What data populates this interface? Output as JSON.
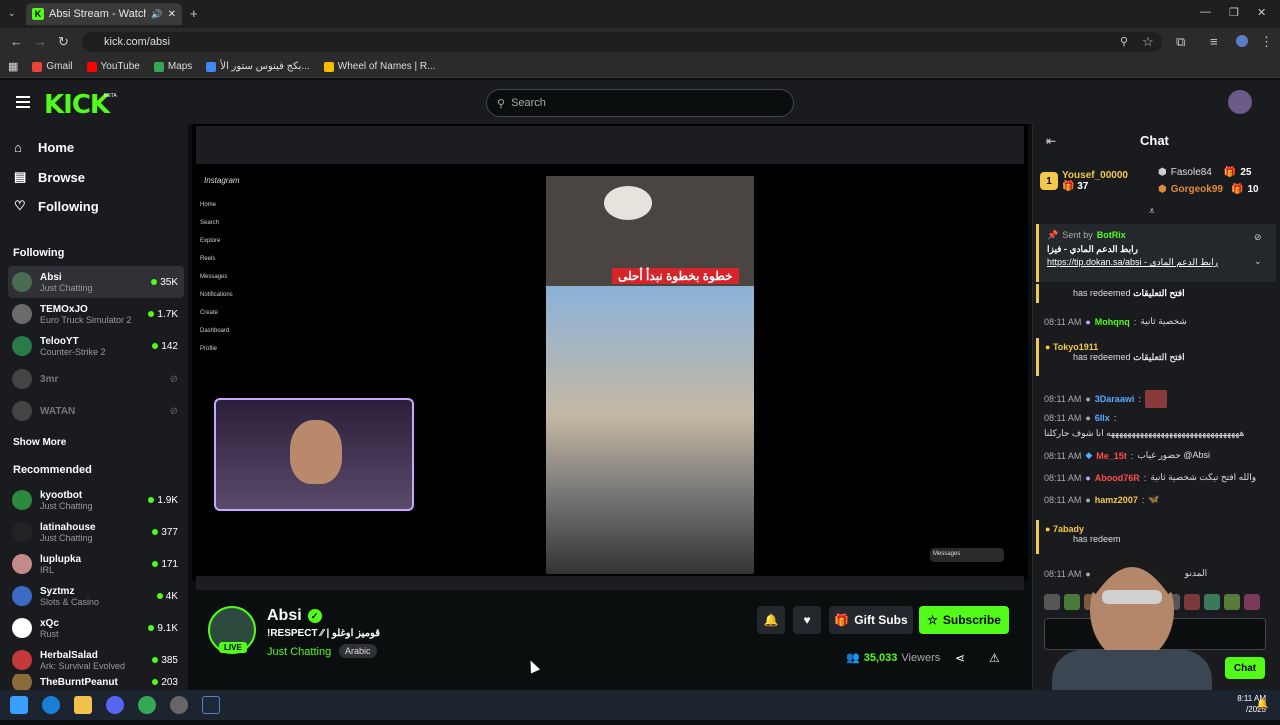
{
  "browser": {
    "tab_title": "Absi Stream - Watch Live o",
    "url": "kick.com/absi",
    "bookmarks": [
      "Gmail",
      "YouTube",
      "Maps",
      "بكج فينوس ستور الأ...",
      "Wheel of Names | R..."
    ]
  },
  "header": {
    "logo": "KICK",
    "beta": "BETA",
    "search_placeholder": "Search"
  },
  "sidebar": {
    "nav": [
      {
        "label": "Home",
        "icon": "home-icon"
      },
      {
        "label": "Browse",
        "icon": "browse-icon"
      },
      {
        "label": "Following",
        "icon": "heart-icon"
      }
    ],
    "following_title": "Following",
    "following": [
      {
        "name": "Absi",
        "category": "Just Chatting",
        "viewers": "35K",
        "live": true,
        "avatar_color": "#4a6b52"
      },
      {
        "name": "TEMOxJO",
        "category": "Euro Truck Simulator 2",
        "viewers": "1.7K",
        "live": true,
        "avatar_color": "#6b6b6b"
      },
      {
        "name": "TelooYT",
        "category": "Counter-Strike 2",
        "viewers": "142",
        "live": true,
        "avatar_color": "#2b7a4a"
      },
      {
        "name": "3mr",
        "category": "",
        "viewers": "",
        "live": false,
        "avatar_color": "#444444"
      },
      {
        "name": "WATAN",
        "category": "",
        "viewers": "",
        "live": false,
        "avatar_color": "#444444"
      }
    ],
    "show_more": "Show More",
    "recommended_title": "Recommended",
    "recommended": [
      {
        "name": "kyootbot",
        "category": "Just Chatting",
        "viewers": "1.9K",
        "avatar_color": "#2b8a3e"
      },
      {
        "name": "latinahouse",
        "category": "Just Chatting",
        "viewers": "377",
        "avatar_color": "#222222"
      },
      {
        "name": "luplupka",
        "category": "IRL",
        "viewers": "171",
        "avatar_color": "#c48a8a"
      },
      {
        "name": "Syztmz",
        "category": "Slots & Casino",
        "viewers": "4K",
        "avatar_color": "#3a6bc4"
      },
      {
        "name": "xQc",
        "category": "Rust",
        "viewers": "9.1K",
        "avatar_color": "#ffffff"
      },
      {
        "name": "HerbalSalad",
        "category": "Ark: Survival Evolved",
        "viewers": "385",
        "avatar_color": "#c43a3a"
      },
      {
        "name": "TheBurntPeanut",
        "category": "",
        "viewers": "203",
        "avatar_color": "#8a6b3a"
      }
    ]
  },
  "stream": {
    "channel": "Absi",
    "title": "!RESPECT ⁄⁄ | قوميز اوغلو",
    "category": "Just Chatting",
    "language": "Arabic",
    "live_label": "LIVE",
    "gift_label": "Gift Subs",
    "subscribe_label": "Subscribe",
    "viewers": "35,033",
    "viewers_label": "Viewers",
    "video_caption": "خطوة بخطوة نبدأ أحلى",
    "ig_nav": [
      "Home",
      "Search",
      "Explore",
      "Reels",
      "Messages",
      "Notifications",
      "Create",
      "Dashboard",
      "Profile"
    ],
    "ig_brand": "Instagram",
    "ig_messages": "Messages"
  },
  "chat": {
    "title": "Chat",
    "leaderboard": [
      {
        "rank": "1",
        "name": "Yousef_00000",
        "score": "37"
      },
      {
        "name": "Fasole84",
        "score": "25"
      },
      {
        "name": "Gorgeok99",
        "score": "10"
      }
    ],
    "pinned": {
      "sent_by": "Sent by",
      "bot": "BotRix",
      "message": "رابط الدعم المادي - فيزا",
      "link": "https://tip.dokan.sa/absi - رابط الدعم المادي"
    },
    "messages": [
      {
        "type": "redeem",
        "user": "",
        "text": "has redeemed",
        "reward": "افتح التعليقات"
      },
      {
        "type": "msg",
        "time": "08:11 AM",
        "user": "Mohqnq",
        "color": "#53fc18",
        "text": "شخصية ثانية"
      },
      {
        "type": "redeem",
        "user": "Tokyo1911",
        "text": "has redeemed",
        "reward": "افتح التعليقات"
      },
      {
        "type": "msg",
        "time": "08:11 AM",
        "user": "3Daraawi",
        "color": "#5aa9ff",
        "text": ""
      },
      {
        "type": "msg",
        "time": "08:11 AM",
        "user": "6llx",
        "color": "#5aa9ff",
        "text": ""
      },
      {
        "type": "plain",
        "text": "ههههههههههههههههههههههههههههههههه انا شوف حاركلنا"
      },
      {
        "type": "msg",
        "time": "08:11 AM",
        "user": "Me_15t",
        "color": "#ff4d4d",
        "text": "حضور غياب @Absi"
      },
      {
        "type": "msg",
        "time": "08:11 AM",
        "user": "Abood76R",
        "color": "#ff4d4d",
        "text": "والله افتح تيكت شخصية ثانية"
      },
      {
        "type": "msg",
        "time": "08:11 AM",
        "user": "hamz2007",
        "color": "#f2c94c",
        "text": ""
      },
      {
        "type": "redeem",
        "user": "7abady",
        "text": "has redeem",
        "reward": ""
      },
      {
        "type": "msg",
        "time": "08:11 AM",
        "user": "",
        "color": "#ffffff",
        "text": "المدنو"
      }
    ],
    "send_label": "Chat"
  },
  "taskbar": {
    "time": "8:11 AM",
    "date": "/2025"
  }
}
